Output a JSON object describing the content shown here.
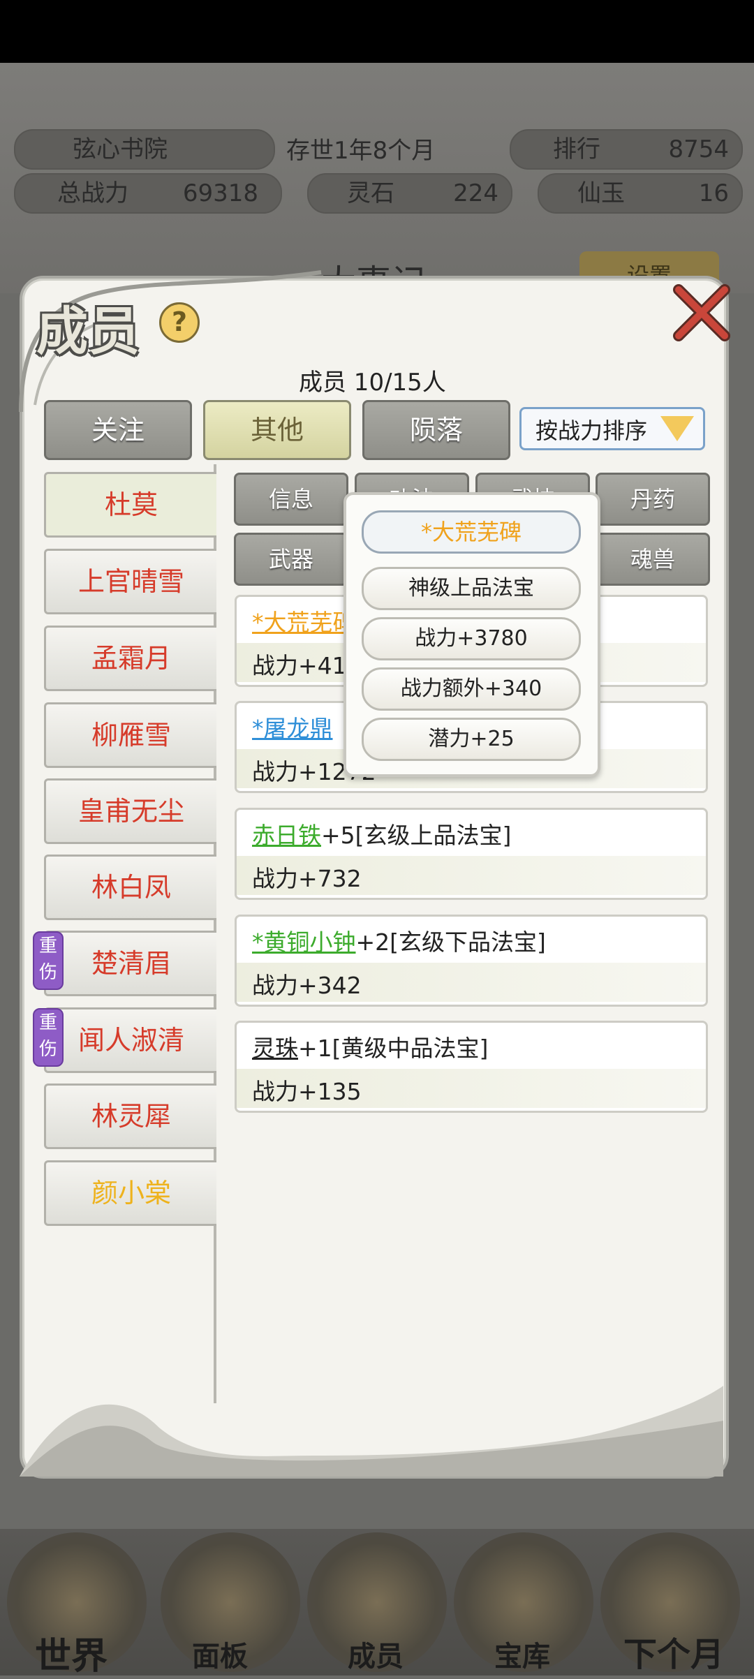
{
  "header": {
    "sect_name": "弦心书院",
    "existence": "存世1年8个月",
    "rank_label": "排行",
    "rank_value": "8754",
    "power_label": "总战力",
    "power_value": "69318",
    "stone_label": "灵石",
    "stone_value": "224",
    "jade_label": "仙玉",
    "jade_value": "16"
  },
  "background": {
    "chronicle": "大事记",
    "settings": "设置"
  },
  "dialog": {
    "title": "成员",
    "help": "?",
    "member_count": "成员  10/15人",
    "filters": [
      "关注",
      "其他",
      "陨落"
    ],
    "sort_label": "按战力排序"
  },
  "members": [
    {
      "name": "杜莫",
      "selected": true
    },
    {
      "name": "上官晴雪"
    },
    {
      "name": "孟霜月"
    },
    {
      "name": "柳雁雪"
    },
    {
      "name": "皇甫无尘"
    },
    {
      "name": "林白凤"
    },
    {
      "name": "楚清眉",
      "injury": "重伤"
    },
    {
      "name": "闻人淑清",
      "injury": "重伤"
    },
    {
      "name": "林灵犀"
    },
    {
      "name": "颜小棠",
      "gold": true
    }
  ],
  "injury_chars": [
    "重",
    "伤"
  ],
  "tabs": {
    "row1": [
      "信息",
      "功法",
      "武技",
      "丹药"
    ],
    "row2": [
      "武器",
      "魂兽"
    ]
  },
  "items": [
    {
      "name": "*大荒芜碑",
      "name_color": "#f0a21c",
      "suffix": "",
      "power": "战力+41"
    },
    {
      "name": "*屠龙鼎",
      "name_color": "#2f8fd8",
      "suffix": "",
      "power": "战力+1272"
    },
    {
      "name": "赤日铁",
      "name_color": "#3cab2c",
      "suffix": "+5[玄级上品法宝]",
      "power": "战力+732"
    },
    {
      "name": "*黄铜小钟",
      "name_color": "#3cab2c",
      "suffix": "+2[玄级下品法宝]",
      "power": "战力+342"
    },
    {
      "name": "灵珠",
      "name_color": "#222222",
      "suffix": "+1[黄级中品法宝]",
      "power": "战力+135"
    }
  ],
  "popup": {
    "title": "*大荒芜碑",
    "lines": [
      "神级上品法宝",
      "战力+3780",
      "战力额外+340",
      "潜力+25"
    ]
  },
  "bottom_nav": [
    "世界",
    "面板",
    "成员",
    "宝库",
    "下个月"
  ],
  "colors": {
    "member_name": "#d63b2a",
    "member_gold": "#eeb21c",
    "injury_badge": "#8e5cc6",
    "popup_title": "#f0a21c"
  }
}
